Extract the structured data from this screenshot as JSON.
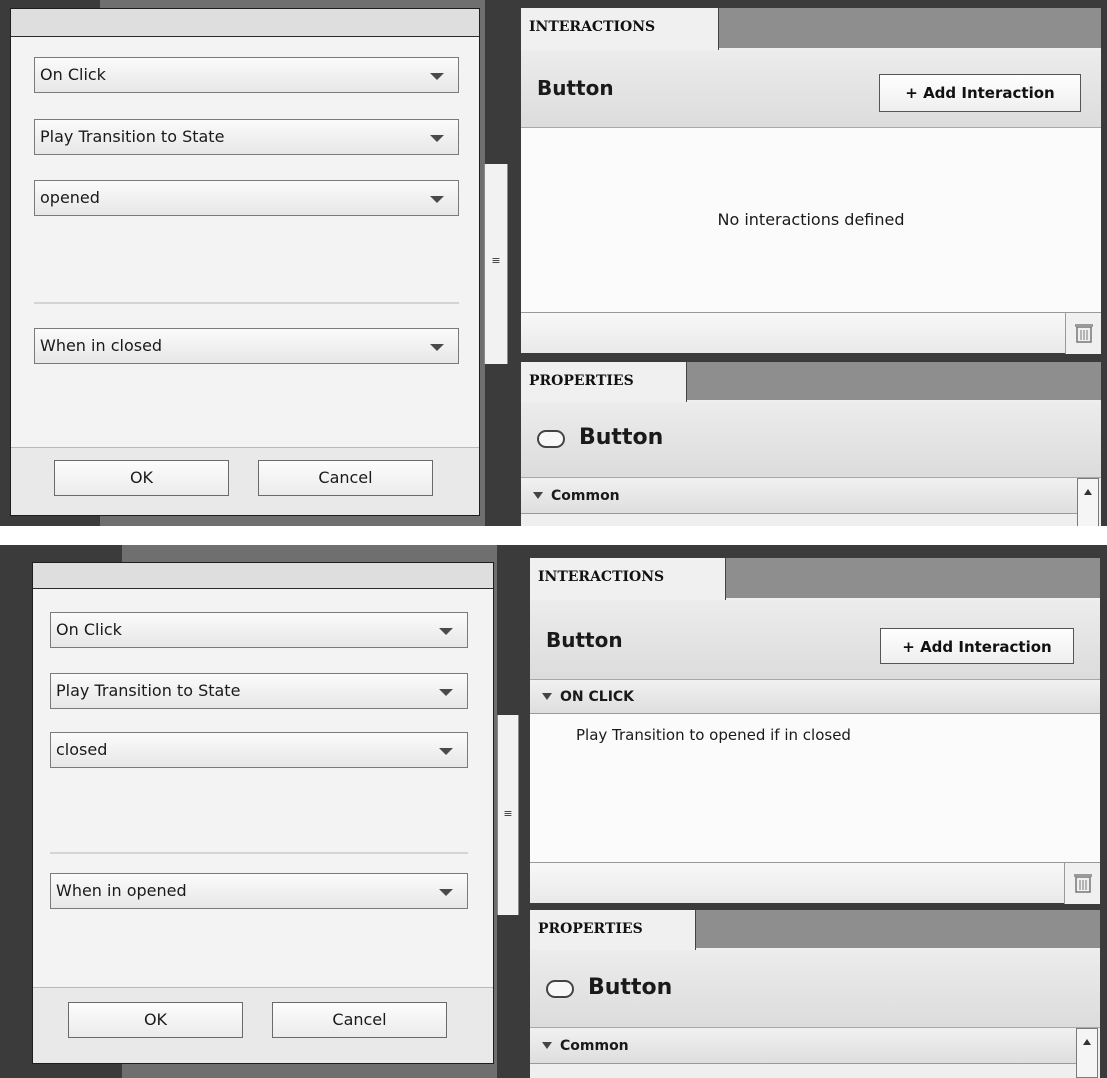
{
  "screens": [
    {
      "dialog": {
        "trigger": "On Click",
        "action": "Play Transition to State",
        "target_state": "opened",
        "condition": "When in closed",
        "ok_label": "OK",
        "cancel_label": "Cancel"
      },
      "interactions": {
        "tab": "INTERACTIONS",
        "title": "Button",
        "add_label": "+ Add Interaction",
        "empty_text": "No interactions defined"
      },
      "properties": {
        "tab": "PROPERTIES",
        "title": "Button",
        "section": "Common"
      }
    },
    {
      "dialog": {
        "trigger": "On Click",
        "action": "Play Transition to State",
        "target_state": "closed",
        "condition": "When in opened",
        "ok_label": "OK",
        "cancel_label": "Cancel"
      },
      "interactions": {
        "tab": "INTERACTIONS",
        "title": "Button",
        "add_label": "+ Add Interaction",
        "section": "ON CLICK",
        "entry": "Play Transition to opened if in closed"
      },
      "properties": {
        "tab": "PROPERTIES",
        "title": "Button",
        "section": "Common"
      }
    }
  ],
  "icons": {
    "dropdown_arrow": "chevron-down-icon",
    "splitter_grip": "grip-icon",
    "trash": "trash-icon",
    "button_component": "button-component-icon",
    "collapse": "collapse-triangle-icon",
    "scroll_up": "scroll-up-icon"
  }
}
